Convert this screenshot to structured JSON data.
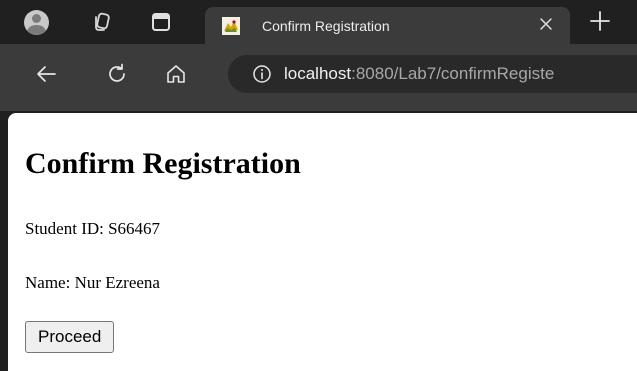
{
  "browser": {
    "tab": {
      "title": "Confirm Registration"
    },
    "address": {
      "host": "localhost",
      "path": ":8080/Lab7/confirmRegiste"
    }
  },
  "page": {
    "heading": "Confirm Registration",
    "student_id_line": "Student ID: S66467",
    "name_line": "Name: Nur Ezreena",
    "proceed_label": "Proceed"
  },
  "icons": {
    "profile": "profile-avatar-icon",
    "workspaces": "workspaces-icon",
    "tab_actions": "tab-actions-icon",
    "favicon": "tomcat-favicon-icon",
    "close": "close-icon",
    "new_tab": "plus-icon",
    "back": "back-arrow-icon",
    "reload": "reload-icon",
    "home": "home-icon",
    "site_info": "info-icon"
  },
  "colors": {
    "tabstrip": "#202020",
    "toolbar": "#3b3b3b",
    "omnibox": "#292929",
    "page": "#ffffff"
  }
}
